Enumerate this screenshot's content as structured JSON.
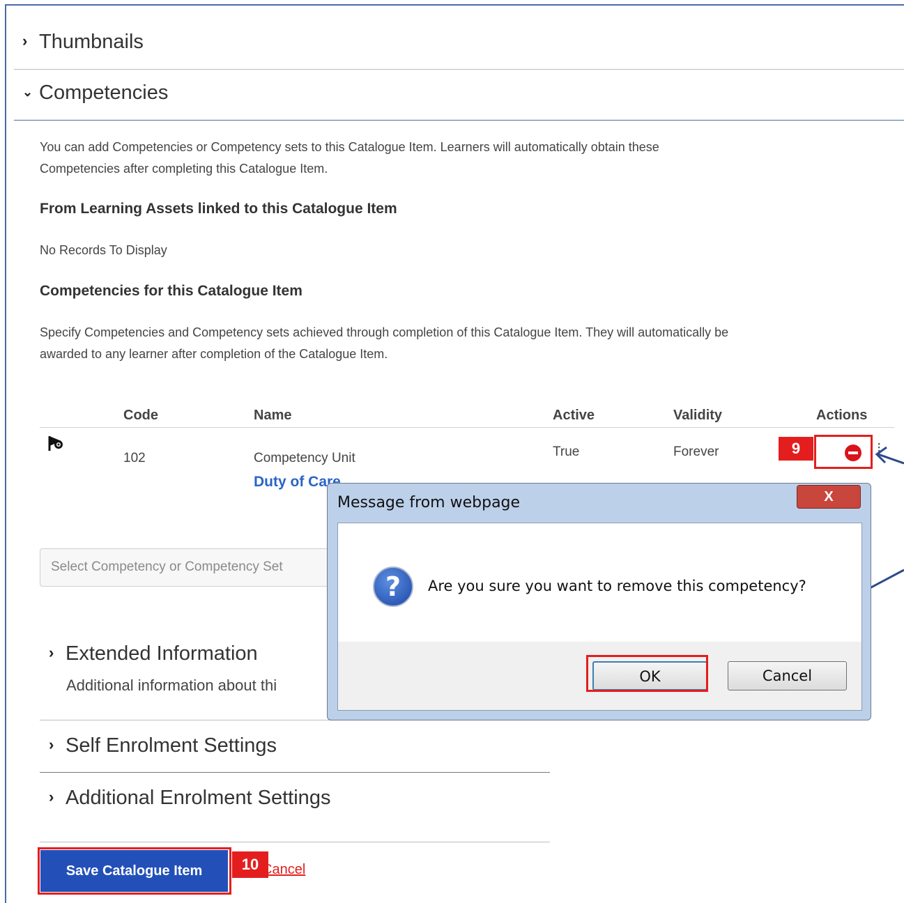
{
  "sections": {
    "thumbnails": "Thumbnails",
    "competencies": "Competencies",
    "extended": "Extended Information",
    "extended_desc": "Additional information about thi",
    "self_enrolment": "Self Enrolment Settings",
    "additional_enrolment": "Additional Enrolment Settings"
  },
  "competencies": {
    "intro_line1": "You can add Competencies or Competency sets to this Catalogue Item. Learners will automatically obtain these",
    "intro_line2": "Competencies after completing this Catalogue Item.",
    "from_assets_heading": "From Learning Assets linked to this Catalogue Item",
    "no_records": "No Records To Display",
    "for_item_heading": "Competencies for this Catalogue Item",
    "specify_line1": "Specify Competencies and Competency sets achieved through completion of this Catalogue Item. They will automatically be",
    "specify_line2": "awarded to any learner after completion of the Catalogue Item.",
    "table": {
      "headers": [
        "Code",
        "Name",
        "Active",
        "Validity",
        "Actions"
      ],
      "rows": [
        {
          "code": "102",
          "name_type": "Competency Unit",
          "name": "Duty of Care",
          "active": "True",
          "validity": "Forever"
        }
      ]
    },
    "select_placeholder": "Select Competency or Competency Set"
  },
  "annotations": {
    "step9": "9",
    "step10": "10"
  },
  "buttons": {
    "save": "Save Catalogue Item",
    "cancel": "Cancel"
  },
  "dialog": {
    "title": "Message from webpage",
    "message": "Are you sure you want to remove this competency?",
    "ok": "OK",
    "cancel": "Cancel",
    "close": "X"
  },
  "icons": {
    "chevron": "chevron-right-icon",
    "chevron_open": "chevron-down-icon",
    "competency": "flag-icon",
    "remove": "remove-circle-icon",
    "question": "question-icon"
  },
  "colors": {
    "accent": "#2350b8",
    "annotation": "#e41e1e",
    "link": "#2a64c5"
  }
}
